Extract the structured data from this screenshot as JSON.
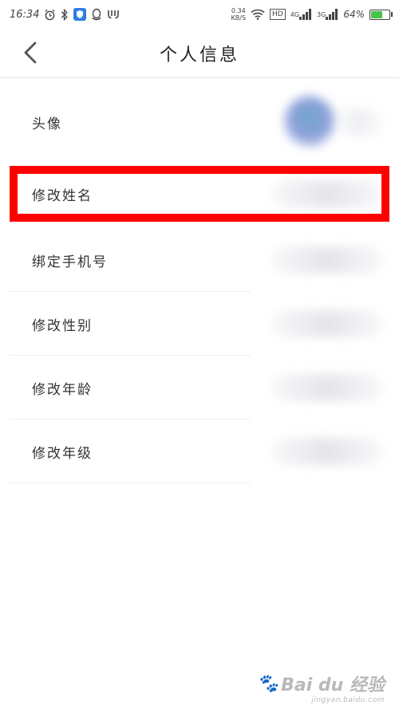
{
  "status_bar": {
    "time": "16:34",
    "speed_value": "0.34",
    "speed_unit": "KB/S",
    "hd": "HD",
    "net1": "4G",
    "net2": "3G",
    "battery": "64%",
    "battery_level": 0.64,
    "battery_color": "#45c34a"
  },
  "header": {
    "title": "个人信息",
    "back_icon": "chevron-left-icon"
  },
  "rows": [
    {
      "label": "头像"
    },
    {
      "label": "修改姓名"
    },
    {
      "label": "绑定手机号"
    },
    {
      "label": "修改性别"
    },
    {
      "label": "修改年龄"
    },
    {
      "label": "修改年级"
    }
  ],
  "highlight_color": "#ff0000",
  "watermark": {
    "main": "Bai du 经验",
    "sub": "jingyan.baidu.com"
  }
}
